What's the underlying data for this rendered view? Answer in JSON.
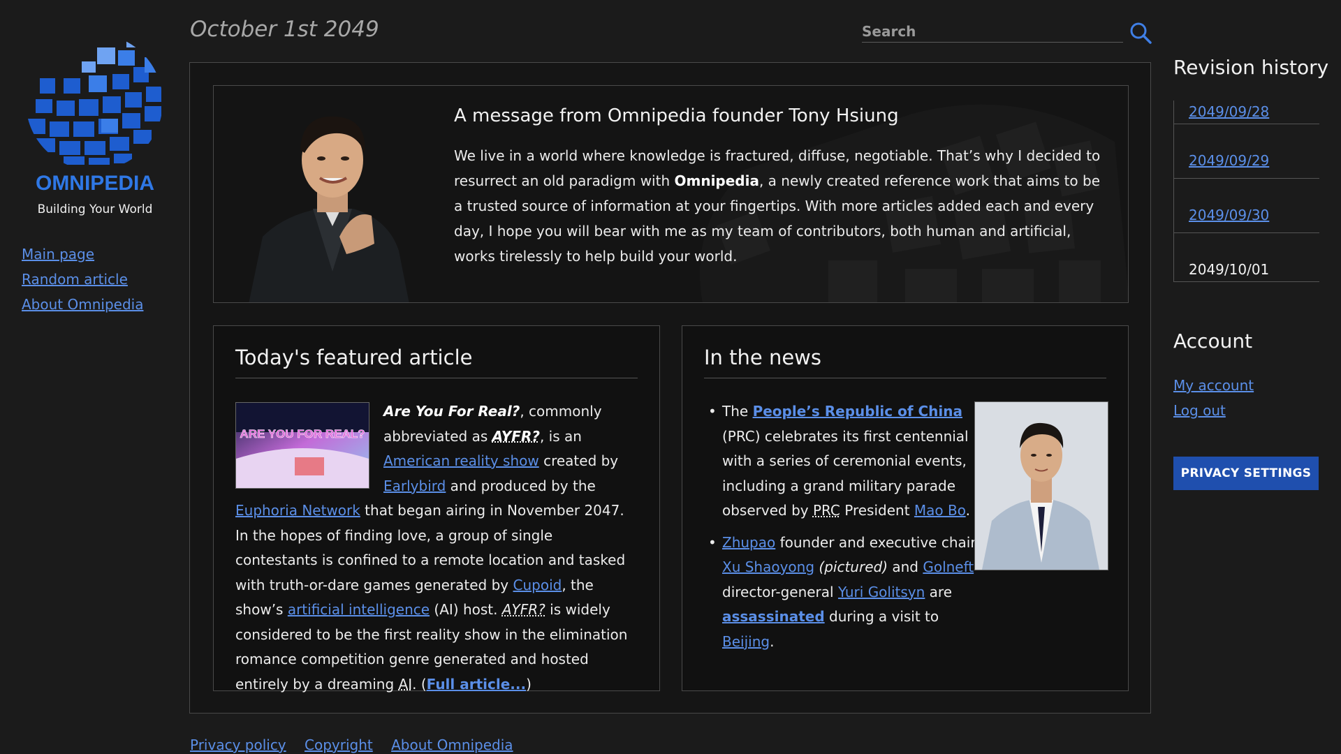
{
  "brand": {
    "name": "OMNIPEDIA",
    "tagline": "Building Your World",
    "accent": "#2f78e6"
  },
  "sidebar": {
    "items": [
      {
        "label": "Main page"
      },
      {
        "label": "Random article"
      },
      {
        "label": "About Omnipedia"
      }
    ]
  },
  "header": {
    "date": "October 1st 2049",
    "search_placeholder": "Search",
    "search_icon": "search-icon"
  },
  "hero": {
    "title": "A message from Omnipedia founder Tony Hsiung",
    "text_before": "We live in a world where knowledge is fractured, diffuse, negotiable. That’s why I decided to resurrect an old paradigm with ",
    "text_bold": "Omnipedia",
    "text_after": ", a newly created reference work that aims to be a trusted source of information at your fingertips. With more articles added each and every day, I hope you will bear with me as my team of contributors, both human and artificial, works tirelessly to help build your world."
  },
  "featured": {
    "title": "Today's featured article",
    "thumb_text": "ARE YOU FOR REAL?",
    "t1": "Are You For Real?",
    "t2": ", commonly abbreviated as ",
    "t3": "AYFR?",
    "t4": ", is an ",
    "l_american_reality": "American reality show",
    "t5": " created by ",
    "l_earlybird": "Earlybird",
    "t6": " and produced by the ",
    "l_euphoria": "Euphoria Network",
    "t7": " that began airing in November 2047. In the hopes of finding love, a group of single contestants is confined to a remote location and tasked with truth-or-dare games generated by ",
    "l_cupoid": "Cupoid",
    "t8": ", the show’s ",
    "l_ai": "artificial intelligence",
    "t9": " (AI) host. ",
    "t10": "AYFR?",
    "t11": " is widely considered to be the first reality show in the elimination romance competition genre generated and hosted entirely by a dreaming ",
    "t12": "AI",
    "t13": ". (",
    "l_full": "Full article...",
    "t14": ")"
  },
  "news": {
    "title": "In the news",
    "item1": {
      "t1": "The ",
      "l_prc": "People’s Republic of China",
      "t2": " (PRC) celebrates its first centennial with a series of ceremonial events, including a grand military parade observed by ",
      "t3": "PRC",
      "t4": " President ",
      "l_mao": "Mao Bo",
      "t5": "."
    },
    "item2": {
      "l_zhupao": "Zhupao",
      "t1": " founder and executive chair ",
      "l_xu": "Xu Shaoyong",
      "t2": " (pictured)",
      "t3": " and ",
      "l_golneft": "Golneft",
      "t4": " director-general ",
      "l_yuri": "Yuri Golitsyn",
      "t5": " are ",
      "l_assassinated": "assassinated",
      "t6": " during a visit to ",
      "l_beijing": "Beijing",
      "t7": "."
    }
  },
  "revisions": {
    "title": "Revision history",
    "items": [
      {
        "label": "2049/09/28"
      },
      {
        "label": "2049/09/29"
      },
      {
        "label": "2049/09/30"
      },
      {
        "label": "2049/10/01"
      }
    ]
  },
  "account": {
    "title": "Account",
    "my_account": "My account",
    "log_out": "Log out",
    "privacy_button": "PRIVACY SETTINGS"
  },
  "footer": {
    "links": [
      {
        "label": "Privacy policy"
      },
      {
        "label": "Copyright"
      },
      {
        "label": "About Omnipedia"
      }
    ]
  }
}
